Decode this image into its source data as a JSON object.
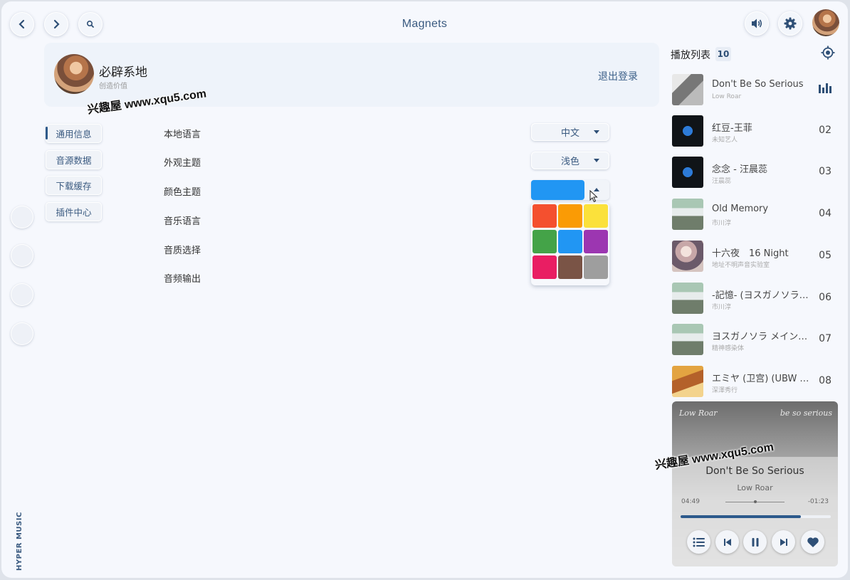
{
  "header": {
    "title": "Magnets"
  },
  "user": {
    "name": "必辟系地",
    "subtitle": "创造价值",
    "logout_label": "退出登录"
  },
  "watermark": "兴趣屋 www.xqu5.com",
  "brand": "HYPER MUSIC",
  "settings_menu": [
    {
      "label": "通用信息",
      "active": true
    },
    {
      "label": "音源数据"
    },
    {
      "label": "下载缓存"
    },
    {
      "label": "插件中心"
    }
  ],
  "settings": {
    "local_language": {
      "label": "本地语言",
      "value": "中文"
    },
    "appearance": {
      "label": "外观主题",
      "value": "浅色"
    },
    "color_theme": {
      "label": "颜色主题",
      "value": "#2196f3"
    },
    "music_language": {
      "label": "音乐语言"
    },
    "quality": {
      "label": "音质选择"
    },
    "output": {
      "label": "音频输出"
    }
  },
  "palette": [
    "#f4502f",
    "#fa9b05",
    "#fbe13b",
    "#44a348",
    "#2196f3",
    "#9c36b1",
    "#e91e63",
    "#7a5446",
    "#9e9e9e"
  ],
  "playlist": {
    "title": "播放列表",
    "count": "10",
    "tracks": [
      {
        "title": "Don't Be So Serious",
        "artist": "Low Roar",
        "playing": true,
        "cover": "cov-grey"
      },
      {
        "title": "红豆-王菲",
        "artist": "未知艺人",
        "num": "02",
        "cover": "cov-dark"
      },
      {
        "title": "念念 - 汪晨蕊",
        "artist": "汪晨蕊",
        "num": "03",
        "cover": "cov-dark"
      },
      {
        "title": "Old Memory",
        "artist": "市川淳",
        "num": "04",
        "cover": "cov-land"
      },
      {
        "title": "十六夜　16 Night",
        "artist": "地址不明声音实验室",
        "num": "05",
        "cover": "cov-girl"
      },
      {
        "title": "-記憶- (ヨスガノソラ…",
        "artist": "市川淳",
        "num": "06",
        "cover": "cov-land"
      },
      {
        "title": "ヨスガノソラ メイン…",
        "artist": "精神感染体",
        "num": "07",
        "cover": "cov-land"
      },
      {
        "title": "エミヤ (卫宫) (UBW …",
        "artist": "深澤秀行",
        "num": "08",
        "cover": "cov-fire"
      }
    ]
  },
  "player": {
    "art_left": "Low Roar",
    "art_right": "be so serious",
    "title": "Don't Be So Serious",
    "artist": "Low Roar",
    "elapsed": "04:49",
    "remaining": "-01:23",
    "progress": 0.8
  }
}
